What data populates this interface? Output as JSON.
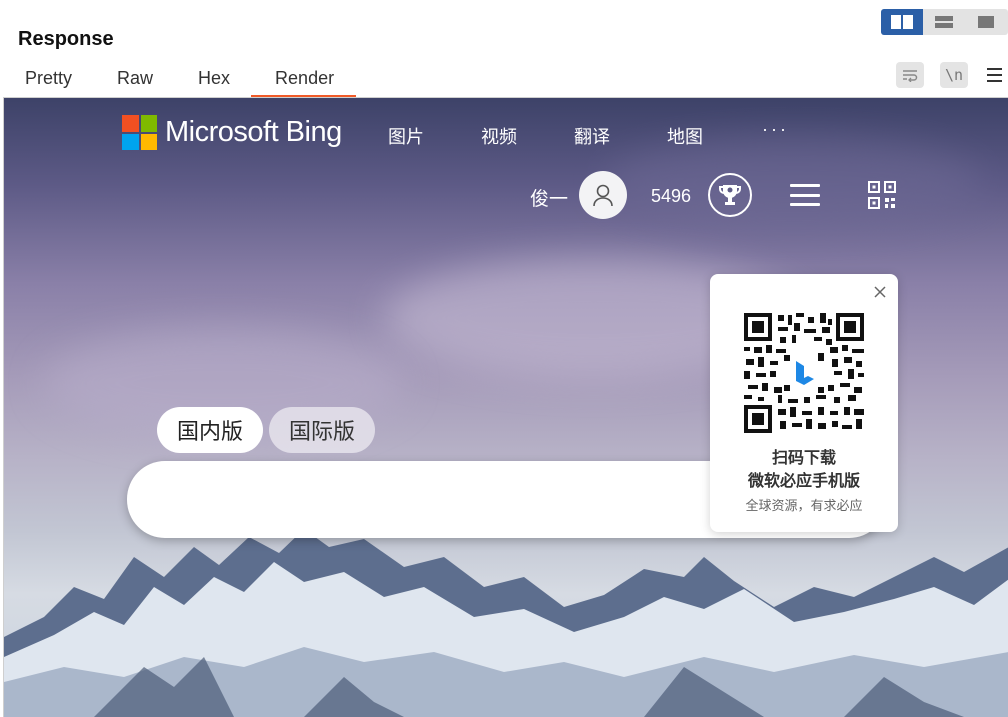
{
  "header": {
    "title": "Response",
    "tabs": [
      {
        "label": "Pretty"
      },
      {
        "label": "Raw"
      },
      {
        "label": "Hex"
      },
      {
        "label": "Render",
        "active": true
      }
    ],
    "wrap_icon": "wrap-lines-icon",
    "newline_label": "\\n",
    "menu_icon": "menu-icon"
  },
  "colors": {
    "active_tab_underline": "#f05a28",
    "layout_active": "#2b5fa7"
  },
  "bing": {
    "logo_text": "Microsoft Bing",
    "logo_colors": [
      "#f25022",
      "#7fba00",
      "#00a4ef",
      "#ffb900"
    ],
    "nav": [
      {
        "label": "图片"
      },
      {
        "label": "视频"
      },
      {
        "label": "翻译"
      },
      {
        "label": "地图"
      }
    ],
    "more_label": "···",
    "user_name": "俊一",
    "points": "5496",
    "scope_tabs": [
      {
        "label": "国内版",
        "active": true
      },
      {
        "label": "国际版",
        "active": false
      }
    ],
    "search_value": "",
    "qr_popup": {
      "line1": "扫码下载",
      "line2": "微软必应手机版",
      "line3": "全球资源，有求必应"
    }
  }
}
